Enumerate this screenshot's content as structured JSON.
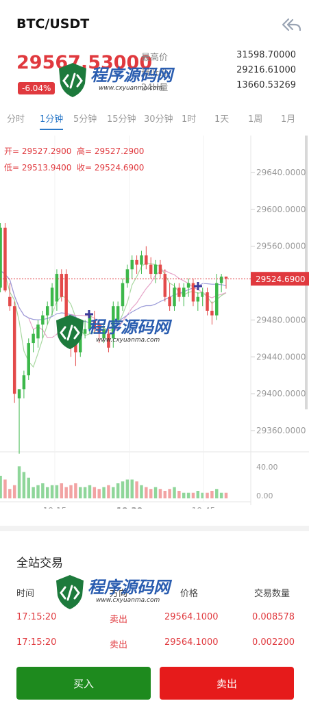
{
  "header": {
    "pair": "BTC/USDT",
    "last_price": "29567.53000",
    "change_pct": "-6.04%",
    "back_icon": "double-back-arrow-icon"
  },
  "stats": [
    {
      "label": "最高价",
      "value": "31598.70000"
    },
    {
      "label": "最低价",
      "value": "29216.61000"
    },
    {
      "label": "24H量",
      "value": "13660.53269"
    }
  ],
  "tabs": [
    {
      "label": "分时",
      "active": false
    },
    {
      "label": "1分钟",
      "active": true
    },
    {
      "label": "5分钟",
      "active": false
    },
    {
      "label": "15分钟",
      "active": false
    },
    {
      "label": "30分钟",
      "active": false
    },
    {
      "label": "1时",
      "active": false
    },
    {
      "label": "1天",
      "active": false
    },
    {
      "label": "1周",
      "active": false
    },
    {
      "label": "1月",
      "active": false
    }
  ],
  "ohlc": {
    "open": "开= 29527.2900",
    "high": "高= 29527.2900",
    "low": "低= 29513.9400",
    "close": "收= 29524.6900"
  },
  "chart_data": {
    "type": "candlestick",
    "price_axis": {
      "ticks": [
        "29640.0000",
        "29600.0000",
        "29560.0000",
        "29480.0000",
        "29440.0000",
        "29400.0000",
        "29360.0000"
      ],
      "range": [
        29340,
        29680
      ]
    },
    "current_price_label": "29524.6900",
    "volume_axis": {
      "ticks": [
        "40.00",
        "0.00"
      ]
    },
    "time_ticks": [
      "19:15",
      "19:30",
      "19:45"
    ],
    "colors": {
      "up": "#3cb84a",
      "down": "#e34a4a",
      "current": "#e0393e",
      "ma1": "#a8d8a0",
      "ma2": "#e6a3c8",
      "ma3": "#9a9ad8"
    },
    "candles": [
      {
        "o": 29600,
        "h": 29612,
        "l": 29580,
        "c": 29590
      },
      {
        "o": 29530,
        "h": 29560,
        "l": 29440,
        "c": 29445
      },
      {
        "o": 29450,
        "h": 29530,
        "l": 29440,
        "c": 29520
      },
      {
        "o": 29515,
        "h": 29585,
        "l": 29510,
        "c": 29580
      },
      {
        "o": 29580,
        "h": 29585,
        "l": 29510,
        "c": 29512
      },
      {
        "o": 29505,
        "h": 29520,
        "l": 29490,
        "c": 29495
      },
      {
        "o": 29495,
        "h": 29500,
        "l": 29390,
        "c": 29400
      },
      {
        "o": 29395,
        "h": 29405,
        "l": 29335,
        "c": 29405
      },
      {
        "o": 29405,
        "h": 29425,
        "l": 29395,
        "c": 29420
      },
      {
        "o": 29420,
        "h": 29460,
        "l": 29415,
        "c": 29455
      },
      {
        "o": 29455,
        "h": 29470,
        "l": 29445,
        "c": 29465
      },
      {
        "o": 29460,
        "h": 29480,
        "l": 29450,
        "c": 29475
      },
      {
        "o": 29475,
        "h": 29490,
        "l": 29460,
        "c": 29485
      },
      {
        "o": 29485,
        "h": 29500,
        "l": 29475,
        "c": 29495
      },
      {
        "o": 29495,
        "h": 29520,
        "l": 29485,
        "c": 29515
      },
      {
        "o": 29500,
        "h": 29535,
        "l": 29490,
        "c": 29530
      },
      {
        "o": 29530,
        "h": 29535,
        "l": 29500,
        "c": 29505
      },
      {
        "o": 29530,
        "h": 29535,
        "l": 29470,
        "c": 29475
      },
      {
        "o": 29475,
        "h": 29480,
        "l": 29440,
        "c": 29460
      },
      {
        "o": 29460,
        "h": 29470,
        "l": 29430,
        "c": 29445
      },
      {
        "o": 29445,
        "h": 29470,
        "l": 29440,
        "c": 29465
      },
      {
        "o": 29465,
        "h": 29480,
        "l": 29460,
        "c": 29470
      },
      {
        "o": 29470,
        "h": 29490,
        "l": 29465,
        "c": 29485
      },
      {
        "o": 29480,
        "h": 29490,
        "l": 29465,
        "c": 29470
      },
      {
        "o": 29475,
        "h": 29480,
        "l": 29455,
        "c": 29465
      },
      {
        "o": 29460,
        "h": 29475,
        "l": 29455,
        "c": 29470
      },
      {
        "o": 29465,
        "h": 29470,
        "l": 29445,
        "c": 29450
      },
      {
        "o": 29460,
        "h": 29500,
        "l": 29450,
        "c": 29495
      },
      {
        "o": 29480,
        "h": 29500,
        "l": 29475,
        "c": 29495
      },
      {
        "o": 29495,
        "h": 29525,
        "l": 29490,
        "c": 29520
      },
      {
        "o": 29520,
        "h": 29540,
        "l": 29515,
        "c": 29535
      },
      {
        "o": 29535,
        "h": 29550,
        "l": 29525,
        "c": 29545
      },
      {
        "o": 29545,
        "h": 29550,
        "l": 29530,
        "c": 29540
      },
      {
        "o": 29540,
        "h": 29555,
        "l": 29530,
        "c": 29550
      },
      {
        "o": 29550,
        "h": 29560,
        "l": 29535,
        "c": 29540
      },
      {
        "o": 29540,
        "h": 29548,
        "l": 29525,
        "c": 29530
      },
      {
        "o": 29530,
        "h": 29545,
        "l": 29520,
        "c": 29540
      },
      {
        "o": 29540,
        "h": 29545,
        "l": 29525,
        "c": 29530
      },
      {
        "o": 29530,
        "h": 29535,
        "l": 29500,
        "c": 29505
      },
      {
        "o": 29505,
        "h": 29520,
        "l": 29490,
        "c": 29495
      },
      {
        "o": 29495,
        "h": 29520,
        "l": 29490,
        "c": 29515
      },
      {
        "o": 29515,
        "h": 29520,
        "l": 29500,
        "c": 29505
      },
      {
        "o": 29505,
        "h": 29520,
        "l": 29495,
        "c": 29515
      },
      {
        "o": 29515,
        "h": 29525,
        "l": 29505,
        "c": 29520
      },
      {
        "o": 29520,
        "h": 29525,
        "l": 29495,
        "c": 29500
      },
      {
        "o": 29500,
        "h": 29510,
        "l": 29490,
        "c": 29505
      },
      {
        "o": 29505,
        "h": 29515,
        "l": 29495,
        "c": 29510
      },
      {
        "o": 29510,
        "h": 29515,
        "l": 29485,
        "c": 29490
      },
      {
        "o": 29490,
        "h": 29500,
        "l": 29475,
        "c": 29485
      },
      {
        "o": 29485,
        "h": 29530,
        "l": 29480,
        "c": 29520
      },
      {
        "o": 29520,
        "h": 29530,
        "l": 29510,
        "c": 29527
      },
      {
        "o": 29527,
        "h": 29527,
        "l": 29514,
        "c": 29525
      }
    ],
    "volumes": [
      20,
      18,
      22,
      24,
      20,
      10,
      14,
      34,
      28,
      22,
      12,
      14,
      16,
      12,
      14,
      14,
      16,
      12,
      14,
      16,
      12,
      12,
      14,
      12,
      10,
      12,
      14,
      12,
      16,
      18,
      20,
      20,
      18,
      14,
      12,
      10,
      12,
      10,
      8,
      10,
      12,
      8,
      6,
      6,
      6,
      8,
      6,
      6,
      8,
      10,
      6,
      6
    ]
  },
  "trades": {
    "title": "全站交易",
    "headers": [
      "时间",
      "方向",
      "价格",
      "交易数量"
    ],
    "rows": [
      {
        "time": "17:15:20",
        "side": "卖出",
        "price": "29564.1000",
        "qty": "0.008578"
      },
      {
        "time": "17:15:20",
        "side": "卖出",
        "price": "29564.1000",
        "qty": "0.002200"
      }
    ]
  },
  "actions": {
    "buy": "买入",
    "sell": "卖出"
  },
  "watermark": {
    "text": "程序源码网",
    "url": "www.cxyuanma.com"
  }
}
